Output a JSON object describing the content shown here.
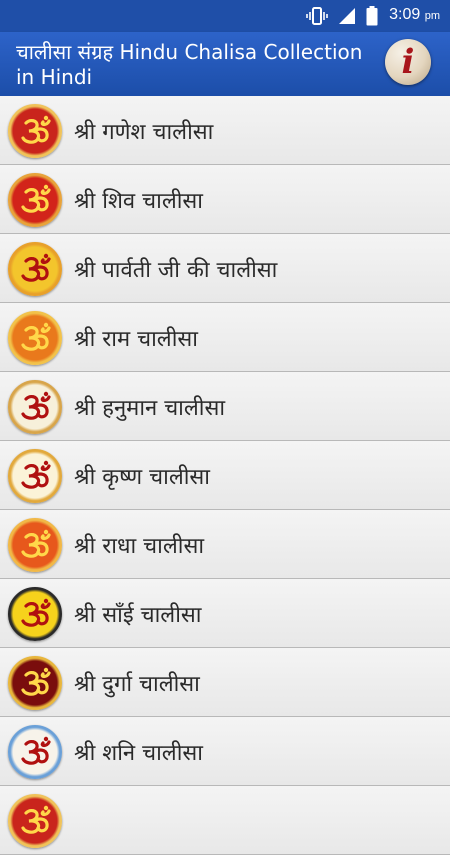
{
  "status": {
    "time": "3:09",
    "ampm": "pm"
  },
  "header": {
    "title": "चालीसा संग्रह Hindu Chalisa Collection in Hindi"
  },
  "items": [
    {
      "label": "श्री गणेश चालीसा",
      "bg": "#c9241c",
      "ring": "#f0c35a"
    },
    {
      "label": "श्री शिव चालीसा",
      "bg": "#d2241a",
      "ring": "#e8a33a"
    },
    {
      "label": "श्री पार्वती जी की चालीसा",
      "bg": "#f3c52c",
      "ring": "#e8a02a"
    },
    {
      "label": "श्री राम चालीसा",
      "bg": "#e9791c",
      "ring": "#f2c24a"
    },
    {
      "label": "श्री हनुमान चालीसा",
      "bg": "#f7f0da",
      "ring": "#d8a54a"
    },
    {
      "label": "श्री कृष्ण चालीसा",
      "bg": "#fbf3d8",
      "ring": "#e2a93c"
    },
    {
      "label": "श्री राधा चालीसा",
      "bg": "#e7581c",
      "ring": "#f1b847"
    },
    {
      "label": "श्री साँई चालीसा",
      "bg": "#f6d21c",
      "ring": "#2a2a2a"
    },
    {
      "label": "श्री दुर्गा चालीसा",
      "bg": "#7a0d0d",
      "ring": "#e8b63c"
    },
    {
      "label": "श्री शनि चालीसा",
      "bg": "#f7f3ea",
      "ring": "#6aa0d8"
    },
    {
      "label": "",
      "bg": "#c9241c",
      "ring": "#f0c35a"
    }
  ]
}
